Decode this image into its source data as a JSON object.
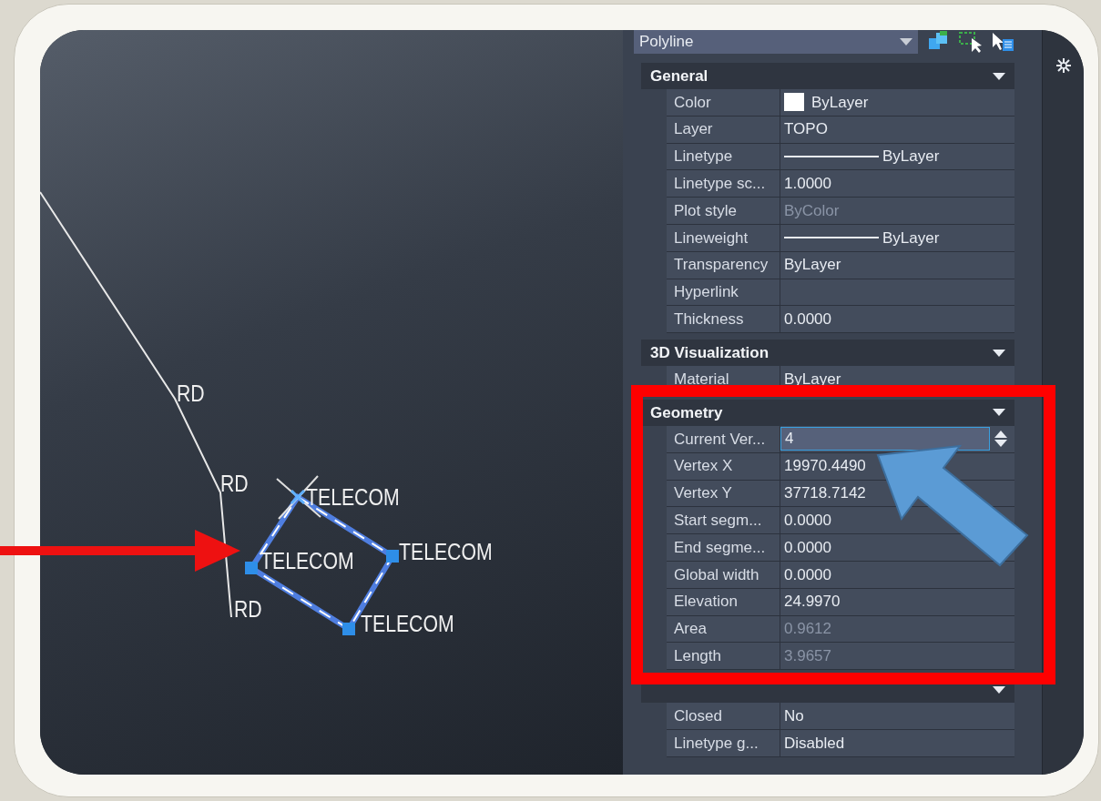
{
  "canvas": {
    "labels": [
      {
        "text": "RD"
      },
      {
        "text": "RD"
      },
      {
        "text": "RD"
      },
      {
        "text": "TELECOM"
      },
      {
        "text": "TELECOM"
      },
      {
        "text": "TELECOM"
      },
      {
        "text": "TELECOM"
      }
    ]
  },
  "properties": {
    "object_type": "Polyline",
    "sections": [
      {
        "title": "General",
        "expanded": true,
        "rows": [
          {
            "label": "Color",
            "value": "ByLayer",
            "kind": "swatch",
            "color": "#ffffff"
          },
          {
            "label": "Layer",
            "value": "TOPO",
            "kind": "text"
          },
          {
            "label": "Linetype",
            "value": "ByLayer",
            "kind": "linetype"
          },
          {
            "label": "Linetype sc...",
            "value": "1.0000",
            "kind": "text"
          },
          {
            "label": "Plot style",
            "value": "ByColor",
            "kind": "text",
            "dimmed": true
          },
          {
            "label": "Lineweight",
            "value": "ByLayer",
            "kind": "linetype"
          },
          {
            "label": "Transparency",
            "value": "ByLayer",
            "kind": "text"
          },
          {
            "label": "Hyperlink",
            "kind": "text"
          },
          {
            "label": "Thickness",
            "value": "0.0000",
            "kind": "text"
          }
        ]
      },
      {
        "title": "3D Visualization",
        "expanded": true,
        "rows": [
          {
            "label": "Material",
            "value": "ByLayer",
            "kind": "text"
          }
        ]
      },
      {
        "title": "Geometry",
        "expanded": true,
        "rows": [
          {
            "label": "Current  Ver...",
            "value": "4",
            "kind": "spinner"
          },
          {
            "label": "Vertex X",
            "value": "19970.4490",
            "kind": "text"
          },
          {
            "label": "Vertex Y",
            "value": "37718.7142",
            "kind": "text"
          },
          {
            "label": "Start  segm...",
            "value": "0.0000",
            "kind": "text"
          },
          {
            "label": "End  segme...",
            "value": "0.0000",
            "kind": "text"
          },
          {
            "label": "Global width",
            "value": "0.0000",
            "kind": "text"
          },
          {
            "label": "Elevation",
            "value": "24.9970",
            "kind": "text"
          },
          {
            "label": "Area",
            "value": "0.9612",
            "kind": "text",
            "dimmed": true
          },
          {
            "label": "Length",
            "value": "3.9657",
            "kind": "text",
            "dimmed": true
          }
        ]
      },
      {
        "expanded": true,
        "rows": [
          {
            "label": "Closed",
            "value": "No",
            "kind": "text"
          },
          {
            "label": "Linetype g...",
            "value": "Disabled",
            "kind": "text"
          }
        ]
      }
    ]
  }
}
